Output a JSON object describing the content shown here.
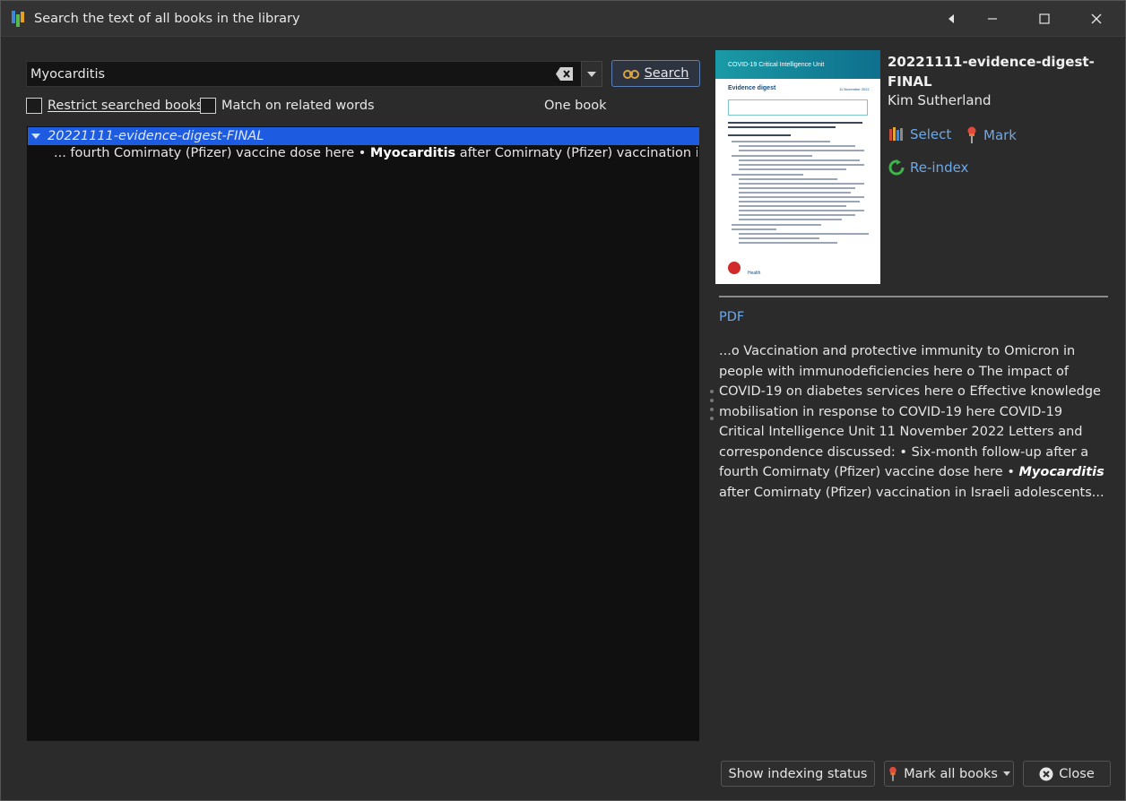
{
  "window": {
    "title": "Search the text of all books in the library"
  },
  "search": {
    "value": "Myocarditis",
    "button_label": "Search"
  },
  "options": {
    "restrict_label": "Restrict searched books",
    "related_label": "Match on related words",
    "scope_text": "One book"
  },
  "results": {
    "book_title": "20221111-evidence-digest-FINAL",
    "snippet_before": "... fourth Comirnaty (Pfizer) vaccine dose here • ",
    "snippet_match": "Myocarditis",
    "snippet_after": " after Comirnaty (Pfizer) vaccination in Israeli a..."
  },
  "details": {
    "title": "20221111-evidence-digest-FINAL",
    "author": "Kim Sutherland",
    "select_label": "Select",
    "mark_label": "Mark",
    "reindex_label": "Re-index",
    "format": "PDF",
    "preview_before": "...o Vaccination and protective immunity to Omicron in people with immunodeficiencies here o The impact of COVID-19 on diabetes services here o Effective knowledge mobilisation in response to COVID-19 here COVID-19 Critical Intelligence Unit 11 November 2022 Letters and correspondence discussed: • Six-month follow-up after a fourth Comirnaty (Pfizer) vaccine dose here • ",
    "preview_match": "Myocarditis",
    "preview_after": " after Comirnaty (Pfizer) vaccination in Israeli adolescents..."
  },
  "cover": {
    "band_text": "COVID-19 Critical Intelligence Unit",
    "heading": "Evidence digest",
    "date": "11 November 2022",
    "footer": "Health"
  },
  "footer": {
    "indexing_label": "Show indexing status",
    "mark_all_label": "Mark all books",
    "close_label": "Close"
  },
  "colors": {
    "accent": "#1d5be0",
    "link": "#6fa8e6"
  }
}
